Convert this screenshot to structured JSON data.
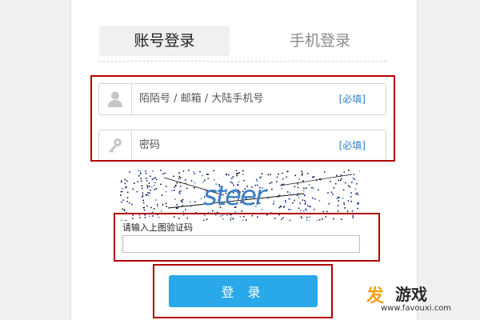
{
  "tabs": {
    "account_login": "账号登录",
    "phone_login": "手机登录"
  },
  "fields": {
    "username_placeholder": "陌陌号 / 邮箱 / 大陆手机号",
    "password_placeholder": "密码",
    "required_tag": "[必填]"
  },
  "captcha": {
    "image_text": "steer",
    "label": "请输入上图验证码",
    "value": ""
  },
  "login_button": "登 录",
  "watermark": {
    "mark": "发",
    "name": "游戏",
    "url": "www.favouxi.com"
  },
  "colors": {
    "accent": "#29a9e9",
    "highlight_box": "#b30000",
    "required_link": "#2a7fcf",
    "captcha_text": "#3c7fc8"
  },
  "icons": [
    "user-icon",
    "key-icon"
  ]
}
